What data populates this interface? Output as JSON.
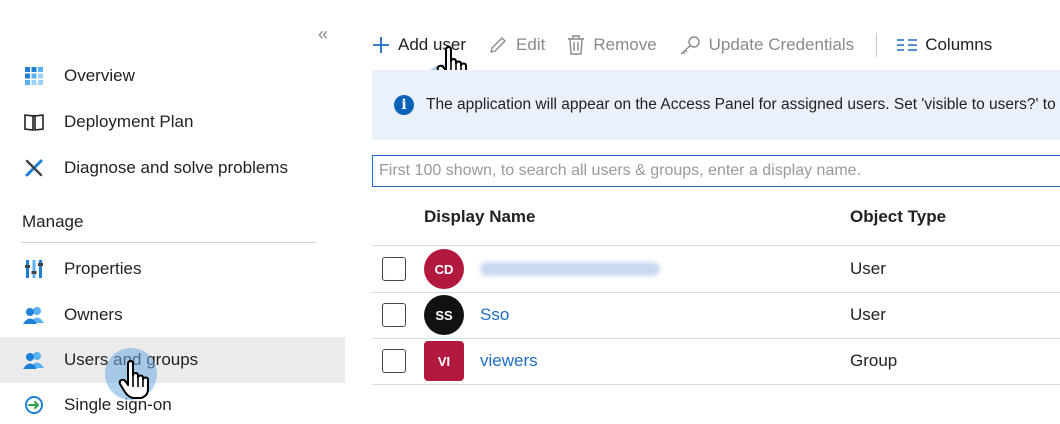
{
  "sidebar": {
    "collapse_glyph": "«",
    "items": [
      {
        "label": "Overview",
        "icon": "overview-grid-icon"
      },
      {
        "label": "Deployment Plan",
        "icon": "book-icon"
      },
      {
        "label": "Diagnose and solve problems",
        "icon": "wrench-cross-icon"
      }
    ],
    "section_label": "Manage",
    "manage_items": [
      {
        "label": "Properties",
        "icon": "properties-bars-icon"
      },
      {
        "label": "Owners",
        "icon": "users-icon"
      },
      {
        "label": "Users and groups",
        "icon": "users-icon",
        "active": true
      },
      {
        "label": "Single sign-on",
        "icon": "sso-arrow-icon"
      }
    ]
  },
  "toolbar": {
    "add_user": "Add user",
    "edit": "Edit",
    "remove": "Remove",
    "update_credentials": "Update Credentials",
    "columns": "Columns"
  },
  "info": {
    "message": "The application will appear on the Access Panel for assigned users. Set 'visible to users?' to no in properties to prevent this."
  },
  "search": {
    "placeholder": "First 100 shown, to search all users & groups, enter a display name."
  },
  "table": {
    "headers": {
      "display_name": "Display Name",
      "object_type": "Object Type"
    },
    "rows": [
      {
        "initials": "CD",
        "name": "",
        "type": "User",
        "avatar_color": "#b3193f"
      },
      {
        "initials": "SS",
        "name": "Sso",
        "type": "User",
        "avatar_color": "#111111"
      },
      {
        "initials": "VI",
        "name": "viewers",
        "type": "Group",
        "avatar_color": "#b3193f"
      }
    ]
  },
  "colors": {
    "accent": "#1f6cc3",
    "info_bg": "#eaf1fb",
    "active_nav_bg": "#ebebeb"
  }
}
